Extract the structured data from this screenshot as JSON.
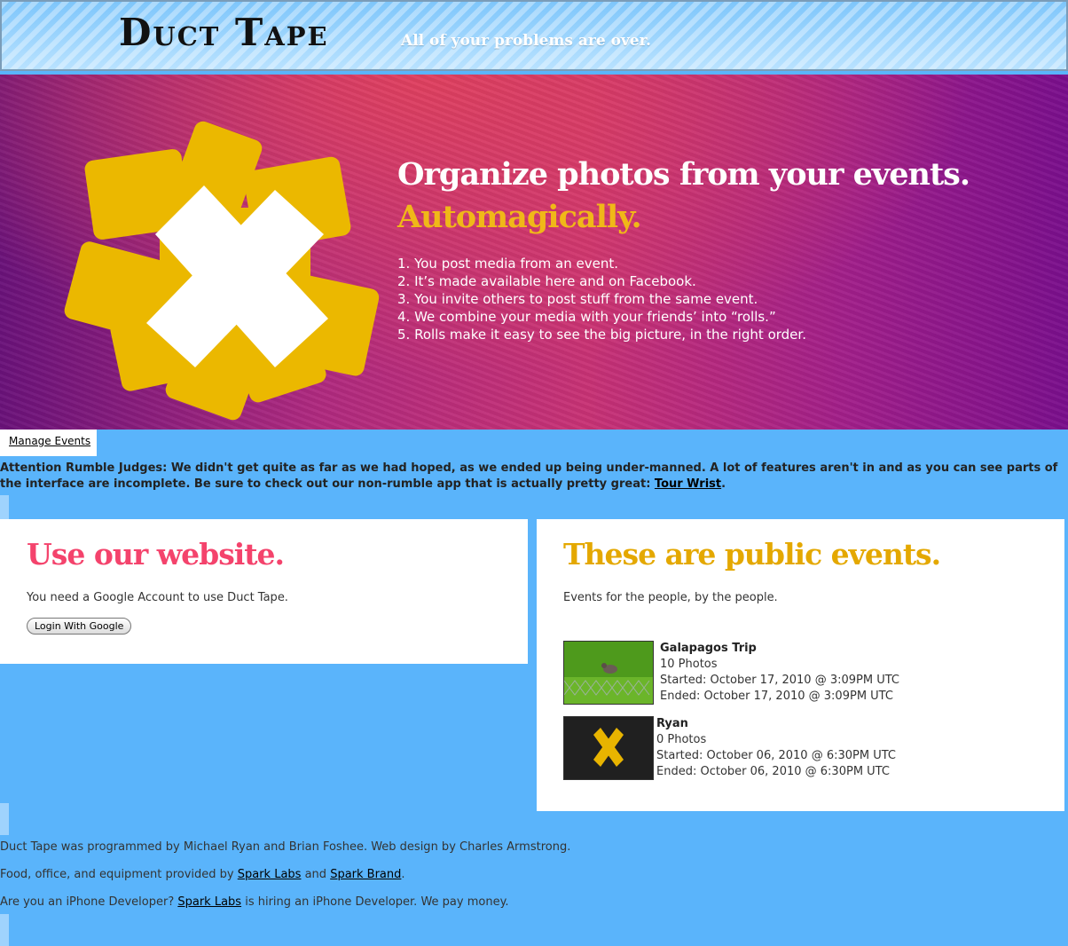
{
  "header": {
    "logo": "Duct Tape",
    "tagline": "All of your problems are over."
  },
  "hero": {
    "title": "Organize photos from your events.",
    "subtitle": "Automagically.",
    "steps": [
      "1. You post media from an event.",
      "2. It’s made available here and on Facebook.",
      "3. You invite others to post stuff from the same event.",
      "4. We combine your media with your friends’ into “rolls.”",
      "5. Rolls make it easy to see the big picture, in the right order."
    ]
  },
  "nav": {
    "manage_events": "Manage Events"
  },
  "notice": {
    "text": "Attention Rumble Judges: We didn't get quite as far as we had hoped, as we ended up being under-manned. A lot of features aren't in and as you can see parts of the interface are incomplete. Be sure to check out our non-rumble app that is actually pretty great: ",
    "link": "Tour Wrist",
    "end": "."
  },
  "login": {
    "title": "Use our website.",
    "text": "You need a Google Account to use Duct Tape.",
    "button": "Login With Google"
  },
  "events": {
    "title": "These are public events.",
    "text": "Events for the people, by the people.",
    "items": [
      {
        "name": "Galapagos Trip",
        "photos": "10 Photos",
        "started": "Started: October 17, 2010 @ 3:09PM UTC",
        "ended": "Ended: October 17, 2010 @ 3:09PM UTC",
        "thumb_icon": "bird-photo"
      },
      {
        "name": "Ryan",
        "photos": "0 Photos",
        "started": "Started: October 06, 2010 @ 6:30PM UTC",
        "ended": "Ended: October 06, 2010 @ 6:30PM UTC",
        "thumb_icon": "duct-tape-x-icon"
      }
    ]
  },
  "footer": {
    "line1": "Duct Tape was programmed by Michael Ryan and Brian Foshee. Web design by Charles Armstrong.",
    "line2_a": "Food, office, and equipment provided by ",
    "line2_link1": "Spark Labs",
    "line2_b": " and ",
    "line2_link2": "Spark Brand",
    "line2_c": ".",
    "line3_a": "Are you an iPhone Developer? ",
    "line3_link": "Spark Labs",
    "line3_b": " is hiring an iPhone Developer. We pay money."
  },
  "colors": {
    "background": "#5ab4fb",
    "login_title": "#f4436c",
    "events_title": "#e4a800",
    "hero_accent": "#f0b818"
  }
}
